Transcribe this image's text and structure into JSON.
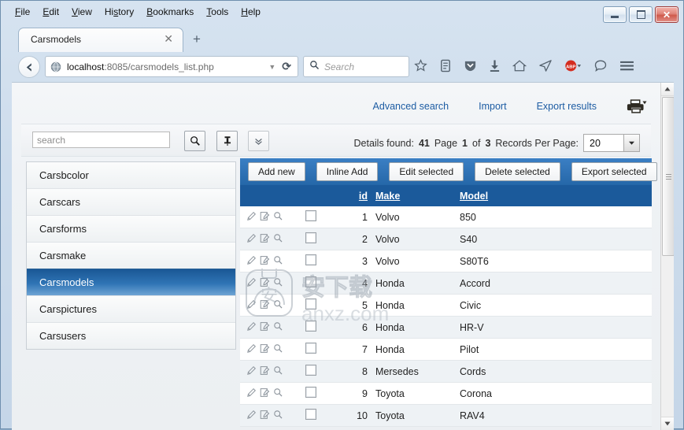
{
  "browser": {
    "menu": [
      {
        "accel": "F",
        "rest": "ile"
      },
      {
        "accel": "E",
        "rest": "dit"
      },
      {
        "accel": "V",
        "rest": "iew"
      },
      {
        "accel": "H",
        "rest": "istory"
      },
      {
        "accel": "B",
        "rest": "ookmarks"
      },
      {
        "accel": "T",
        "rest": "ools"
      },
      {
        "accel": "H",
        "rest": "elp"
      }
    ],
    "menu_labels": [
      "File",
      "Edit",
      "View",
      "History",
      "Bookmarks",
      "Tools",
      "Help"
    ],
    "window_buttons": {
      "minimize": "minimize-button",
      "maximize": "maximize-button",
      "close": "✕"
    },
    "tab": {
      "title": "Carsmodels",
      "close": "✕",
      "new_tab": "+"
    },
    "url": {
      "host": "localhost",
      "path": ":8085/carsmodels_list.php",
      "full": "localhost:8085/carsmodels_list.php",
      "dropdown": "▼",
      "reload": "⟳"
    },
    "search": {
      "placeholder": "Search"
    },
    "toolbar_icons": [
      "bookmark-star-icon",
      "reader-list-icon",
      "pocket-shield-icon",
      "downloads-arrow-icon",
      "home-icon",
      "send-tab-icon",
      "adblock-plus-icon",
      "sync-chat-icon",
      "hamburger-menu-icon"
    ],
    "adblock_label": "ABP"
  },
  "page": {
    "top_links": [
      {
        "label": "Advanced search",
        "name": "advanced-search-link"
      },
      {
        "label": "Import",
        "name": "import-link"
      },
      {
        "label": "Export results",
        "name": "export-results-link"
      }
    ],
    "print_icon": "printer-icon",
    "search": {
      "placeholder": "search",
      "value": "",
      "buttons": [
        {
          "name": "search-submit-button",
          "icon": "magnifier-icon"
        },
        {
          "name": "pin-filter-button",
          "icon": "pin-icon"
        },
        {
          "name": "expand-search-button",
          "icon": "chevron-double-down-icon"
        }
      ]
    },
    "pager": {
      "details_label": "Details found:",
      "details_count": "41",
      "page_label": "Page",
      "page_current": "1",
      "page_of": "of",
      "page_total": "3",
      "rpp_label": "Records Per Page:",
      "rpp_value": "20"
    },
    "sidebar": {
      "items": [
        {
          "label": "Carsbcolor",
          "active": false
        },
        {
          "label": "Carscars",
          "active": false
        },
        {
          "label": "Carsforms",
          "active": false
        },
        {
          "label": "Carsmake",
          "active": false
        },
        {
          "label": "Carsmodels",
          "active": true
        },
        {
          "label": "Carspictures",
          "active": false
        },
        {
          "label": "Carsusers",
          "active": false
        }
      ]
    },
    "actions": [
      {
        "label": "Add new",
        "name": "add-new-button"
      },
      {
        "label": "Inline Add",
        "name": "inline-add-button"
      },
      {
        "label": "Edit selected",
        "name": "edit-selected-button"
      },
      {
        "label": "Delete selected",
        "name": "delete-selected-button"
      },
      {
        "label": "Export selected",
        "name": "export-selected-button"
      }
    ],
    "table": {
      "columns": [
        "id",
        "Make",
        "Model"
      ],
      "rows": [
        {
          "id": "1",
          "make": "Volvo",
          "model": "850"
        },
        {
          "id": "2",
          "make": "Volvo",
          "model": "S40"
        },
        {
          "id": "3",
          "make": "Volvo",
          "model": "S80T6"
        },
        {
          "id": "4",
          "make": "Honda",
          "model": "Accord"
        },
        {
          "id": "5",
          "make": "Honda",
          "model": "Civic"
        },
        {
          "id": "6",
          "make": "Honda",
          "model": "HR-V"
        },
        {
          "id": "7",
          "make": "Honda",
          "model": "Pilot"
        },
        {
          "id": "8",
          "make": "Mersedes",
          "model": "Cords"
        },
        {
          "id": "9",
          "make": "Toyota",
          "model": "Corona"
        },
        {
          "id": "10",
          "make": "Toyota",
          "model": "RAV4"
        }
      ],
      "row_icons": [
        "pencil-edit-icon",
        "copy-edit-icon",
        "magnifier-view-icon"
      ],
      "checkbox_name": "row-select-checkbox"
    },
    "watermark": {
      "text_cn": "安下载",
      "text_latin": "anxz.com"
    }
  },
  "colors": {
    "accent_blue": "#1b5a9b",
    "link_blue": "#1d5ca3",
    "header_bar": "#1b5a9b",
    "action_bar": "#2567a8",
    "row_alt": "#eef2f5"
  }
}
